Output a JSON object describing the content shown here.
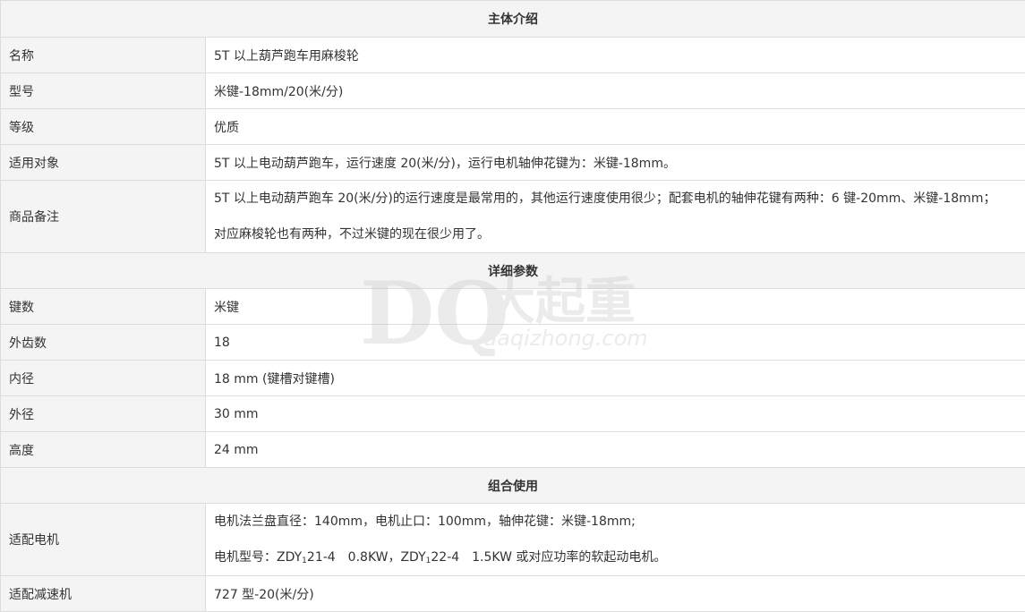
{
  "sections": {
    "intro": "主体介绍",
    "details": "详细参数",
    "combo": "组合使用"
  },
  "rows": {
    "name": {
      "label": "名称",
      "value": "5T 以上葫芦跑车用麻梭轮"
    },
    "model": {
      "label": "型号",
      "value": "米键-18mm/20(米/分)"
    },
    "grade": {
      "label": "等级",
      "value": "优质"
    },
    "target": {
      "label": "适用对象",
      "value": "5T 以上电动葫芦跑车，运行速度 20(米/分)，运行电机轴伸花键为：米键-18mm。"
    },
    "remark": {
      "label": "商品备注",
      "line1": "5T 以上电动葫芦跑车 20(米/分)的运行速度是最常用的，其他运行速度使用很少；配套电机的轴伸花键有两种：6 键-20mm、米键-18mm；",
      "line2": "对应麻梭轮也有两种，不过米键的现在很少用了。"
    },
    "keys": {
      "label": "键数",
      "value": "米键"
    },
    "teeth": {
      "label": "外齿数",
      "value": "18"
    },
    "inner": {
      "label": "内径",
      "value": "18 mm (键槽对键槽)"
    },
    "outer": {
      "label": "外径",
      "value": "30 mm"
    },
    "height": {
      "label": "高度",
      "value": "24 mm"
    },
    "motor": {
      "label": "适配电机",
      "line1": "电机法兰盘直径：140mm，电机止口：100mm，轴伸花键：米键-18mm;",
      "line2_a": "电机型号：ZDY",
      "sub1": "1",
      "line2_b": "21-4　0.8KW，ZDY",
      "sub2": "1",
      "line2_c": "22-4　1.5KW 或对应功率的软起动电机。"
    },
    "reducer": {
      "label": "适配减速机",
      "value": "727 型-20(米/分)"
    }
  },
  "watermark": {
    "brand": "大起重",
    "domain": "daqizhong.com",
    "mark": "DQ"
  }
}
